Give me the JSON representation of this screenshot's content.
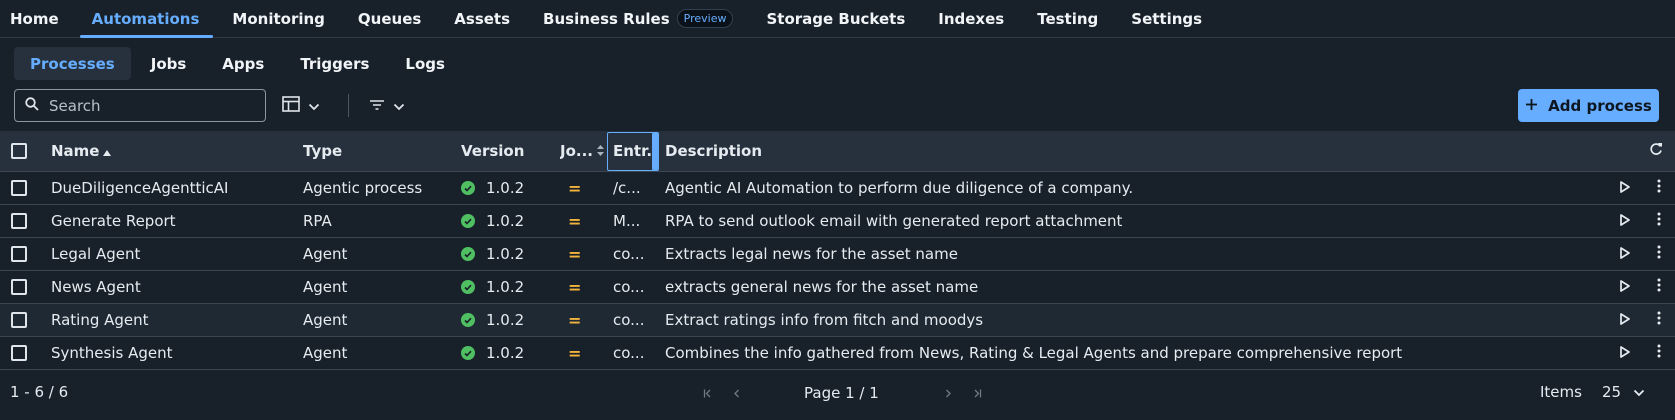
{
  "topnav": {
    "items": [
      {
        "label": "Home"
      },
      {
        "label": "Automations",
        "active": true
      },
      {
        "label": "Monitoring"
      },
      {
        "label": "Queues"
      },
      {
        "label": "Assets"
      },
      {
        "label": "Business Rules",
        "badge": "Preview"
      },
      {
        "label": "Storage Buckets"
      },
      {
        "label": "Indexes"
      },
      {
        "label": "Testing"
      },
      {
        "label": "Settings"
      }
    ]
  },
  "subnav": {
    "tabs": [
      {
        "label": "Processes",
        "active": true
      },
      {
        "label": "Jobs"
      },
      {
        "label": "Apps"
      },
      {
        "label": "Triggers"
      },
      {
        "label": "Logs"
      }
    ]
  },
  "toolbar": {
    "search_placeholder": "Search",
    "search_value": "",
    "add_label": "Add process"
  },
  "table": {
    "columns": {
      "name": "Name",
      "type": "Type",
      "version": "Version",
      "jobs": "Jo...",
      "entry": "Entr...",
      "description": "Description"
    },
    "rows": [
      {
        "name": "DueDiligenceAgentticAI",
        "type": "Agentic process",
        "version": "1.0.2",
        "entry": "/c...",
        "description": "Agentic AI Automation to perform due diligence of a company."
      },
      {
        "name": "Generate Report",
        "type": "RPA",
        "version": "1.0.2",
        "entry": "M...",
        "description": "RPA to send outlook email with generated report attachment"
      },
      {
        "name": "Legal Agent",
        "type": "Agent",
        "version": "1.0.2",
        "entry": "co...",
        "description": "Extracts legal news for the asset name"
      },
      {
        "name": "News Agent",
        "type": "Agent",
        "version": "1.0.2",
        "entry": "co...",
        "description": "extracts general news for the asset name"
      },
      {
        "name": "Rating Agent",
        "type": "Agent",
        "version": "1.0.2",
        "entry": "co...",
        "description": "Extract ratings info from fitch and moodys",
        "highlight": true
      },
      {
        "name": "Synthesis Agent",
        "type": "Agent",
        "version": "1.0.2",
        "entry": "co...",
        "description": "Combines the info gathered from News, Rating & Legal Agents and prepare comprehensive report"
      }
    ]
  },
  "footer": {
    "range": "1 - 6 / 6",
    "page_text": "Page 1 / 1",
    "items_label": "Items",
    "items_value": "25"
  },
  "colors": {
    "accent": "#66adff",
    "success": "#4fbf62",
    "warning": "#f2b33d",
    "background": "#182029"
  }
}
